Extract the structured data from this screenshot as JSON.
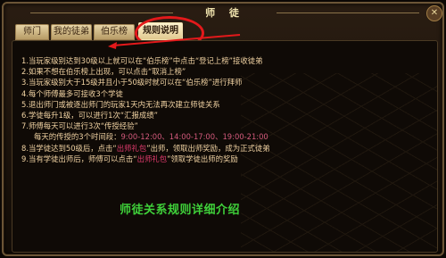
{
  "window": {
    "title": "师 徒"
  },
  "tabs": [
    {
      "label": "师门",
      "active": false
    },
    {
      "label": "我的徒弟",
      "active": false
    },
    {
      "label": "伯乐榜",
      "active": false
    },
    {
      "label": "规则说明",
      "active": true
    }
  ],
  "rules": [
    "1.当玩家级别达到30级以上就可以在“伯乐榜”中点击“登记上榜”接收徒弟",
    "2.如果不想在伯乐榜上出现，可以点击“取消上榜”",
    "3.当玩家级别大于15级并且小于50级时就可以在“伯乐榜”进行拜师",
    "4.每个师傅最多可接收3个学徒",
    "5.退出师门或被逐出师门的玩家1天内无法再次建立师徒关系",
    "6.学徒每升1级，可以进行1次“汇报成绩”",
    "7.师傅每天可以进行3次“传授经验”"
  ],
  "rule_time": {
    "prefix": "每天的传授的3个时间段：",
    "times": "9:00-12:00、14:00-17:00、19:00-21:00"
  },
  "rule8": {
    "prefix": "8.当学徒达到50级后，点击“",
    "highlight": "出师礼包",
    "suffix": "”出师，领取出师奖励，成为正式徒弟"
  },
  "rule9": {
    "prefix": "9.当有学徒出师后，师傅可以点击“",
    "highlight": "出师礼包",
    "suffix": "”领取学徒出师的奖励"
  },
  "footer_note": "师徒关系规则详细介绍",
  "colors": {
    "frame": "#6b5536",
    "rule_text": "#f0d2a2",
    "highlight": "#e03b6d",
    "annotation_red": "#e3191b",
    "footer_green": "#3fd13a"
  },
  "icons": {
    "close": "close-icon"
  }
}
